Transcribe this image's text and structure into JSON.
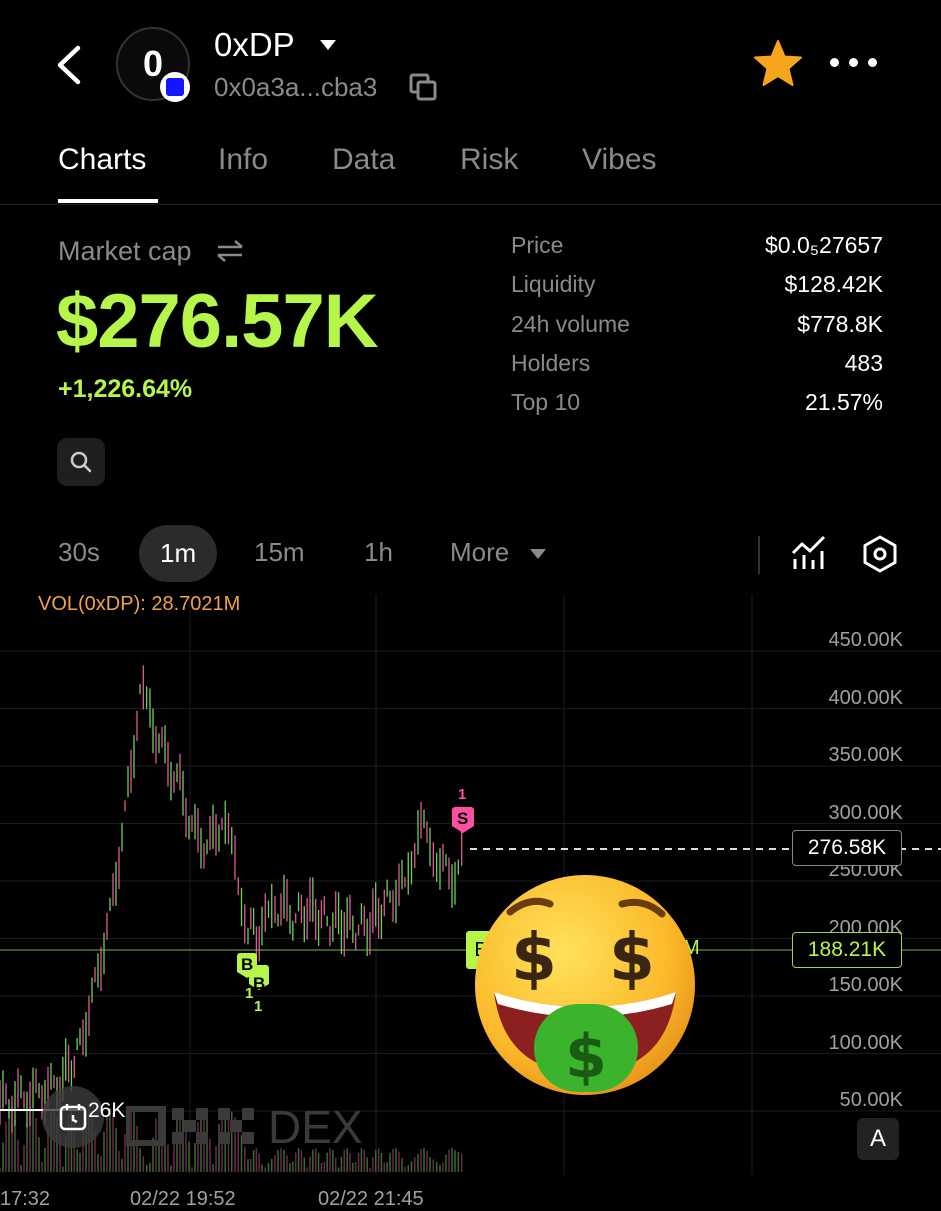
{
  "header": {
    "avatar_letter": "0",
    "token_name": "0xDP",
    "address": "0x0a3a...cba3"
  },
  "tabs": [
    {
      "label": "Charts",
      "active": true
    },
    {
      "label": "Info",
      "active": false
    },
    {
      "label": "Data",
      "active": false
    },
    {
      "label": "Risk",
      "active": false
    },
    {
      "label": "Vibes",
      "active": false
    }
  ],
  "market": {
    "label": "Market cap",
    "value": "$276.57K",
    "change": "+1,226.64%"
  },
  "stats": [
    {
      "label": "Price",
      "value": "$0.0₅27657"
    },
    {
      "label": "Liquidity",
      "value": "$128.42K"
    },
    {
      "label": "24h volume",
      "value": "$778.8K"
    },
    {
      "label": "Holders",
      "value": "483"
    },
    {
      "label": "Top 10",
      "value": "21.57%"
    }
  ],
  "intervals": [
    {
      "label": "30s",
      "active": false
    },
    {
      "label": "1m",
      "active": true
    },
    {
      "label": "15m",
      "active": false
    },
    {
      "label": "1h",
      "active": false
    },
    {
      "label": "More",
      "active": false
    }
  ],
  "chart": {
    "vol_label": "VOL(0xDP): 28.7021M",
    "y_labels": [
      "450.00K",
      "400.00K",
      "350.00K",
      "300.00K",
      "250.00K",
      "200.00K",
      "150.00K",
      "100.00K",
      "50.00K"
    ],
    "current_price_tag": "276.58K",
    "buy_price_tag": "188.21K",
    "x_labels": [
      "17:32",
      "02/22 19:52",
      "02/22 21:45"
    ],
    "partial_label": "26K",
    "watermark": "DEX",
    "a_button": "A",
    "markers": [
      {
        "letter": "B",
        "count": "1",
        "color": "#b6f54a"
      },
      {
        "letter": "B",
        "count": "1",
        "color": "#b6f54a"
      },
      {
        "letter": "S",
        "count": "1",
        "color": "#ff4fa3"
      }
    ],
    "buy_label_left": "B",
    "buy_label_right": "M"
  },
  "colors": {
    "accent_green": "#b6f54a",
    "sell_pink": "#ff4fa3",
    "star": "#f7a51c"
  }
}
